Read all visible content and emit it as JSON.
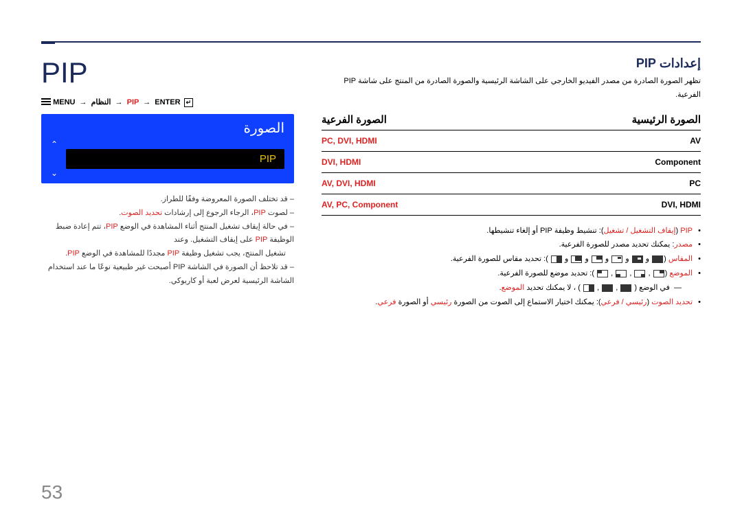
{
  "page_number": "53",
  "big_title": "PIP",
  "breadcrumb": {
    "menu": "MENU",
    "system": "النظام",
    "pip": "PIP",
    "enter": "ENTER"
  },
  "osd": {
    "header": "الصورة",
    "item": "PIP"
  },
  "notes": [
    {
      "pre": "قد تختلف الصورة المعروضة وفقًا للطراز."
    },
    {
      "pre": "لصوت ",
      "red1": "PIP",
      "mid": "، الرجاء الرجوع إلى إرشادات ",
      "red2": "تحديد الصوت",
      "post": "."
    },
    {
      "pre": "في حالة إيقاف تشغيل المنتج أثناء المشاهدة في الوضع ",
      "red1": "PIP",
      "mid": "، تتم إعادة ضبط الوظيفة ",
      "red2": "PIP",
      "post": " على إيقاف التشغيل. وعند"
    },
    {
      "pre": "تشغيل المنتج، يجب تشغيل وظيفة ",
      "red1": "PIP",
      "mid": " مجددًا للمشاهدة في الوضع ",
      "red2": "PIP",
      "post": "."
    },
    {
      "pre": "قد تلاحظ أن الصورة في الشاشة PIP أصبحت غير طبيعية نوعًا ما عند استخدام الشاشة الرئيسية لعرض لعبة أو كاريوكي."
    }
  ],
  "section_heading": "إعدادات PIP",
  "intro": "تظهر الصورة الصادرة من مصدر الفيديو الخارجي على الشاشة الرئيسية والصورة الصادرة من المنتج على شاشة PIP الفرعية.",
  "table": {
    "head_left": "الصورة الرئيسية",
    "head_right": "الصورة الفرعية",
    "rows": [
      {
        "left": "AV",
        "right": "PC, DVI, HDMI",
        "right_red": true
      },
      {
        "left": "Component",
        "right": "DVI, HDMI",
        "right_red": true
      },
      {
        "left": "PC",
        "right": "AV, DVI, HDMI",
        "right_red": true
      },
      {
        "left": "DVI, HDMI",
        "right": "AV, PC, Component",
        "right_red": true
      }
    ]
  },
  "bullets": {
    "b1_red": "PIP",
    "b1_mid": " (",
    "b1_red2": "إيقاف التشغيل / تشغيل",
    "b1_post": "): تنشيط وظيفة PIP أو إلغاء تنشيطها.",
    "b2_red": "مصدر",
    "b2_post": ": يمكنك تحديد مصدر للصورة الفرعية.",
    "b3_red": "المقاس",
    "b3_post": "): تحديد مقاس للصورة الفرعية.",
    "b4_red": "الموضع",
    "b4_post": "): تحديد موضع للصورة الفرعية.",
    "b4_note_pre": "في الوضع (",
    "b4_note_post": ") ، لا يمكنك تحديد ",
    "b4_note_red": "الموضع",
    "b4_note_end": ".",
    "b5_red": "تحديد الصوت",
    "b5_mid": " (",
    "b5_red2": "رئيسي / فرعي",
    "b5_post": "): يمكنك اختيار الاستماع إلى الصوت من الصورة ",
    "b5_red3": "رئيسي",
    "b5_post2": " أو الصورة ",
    "b5_red4": "فرعي",
    "b5_end": "."
  }
}
